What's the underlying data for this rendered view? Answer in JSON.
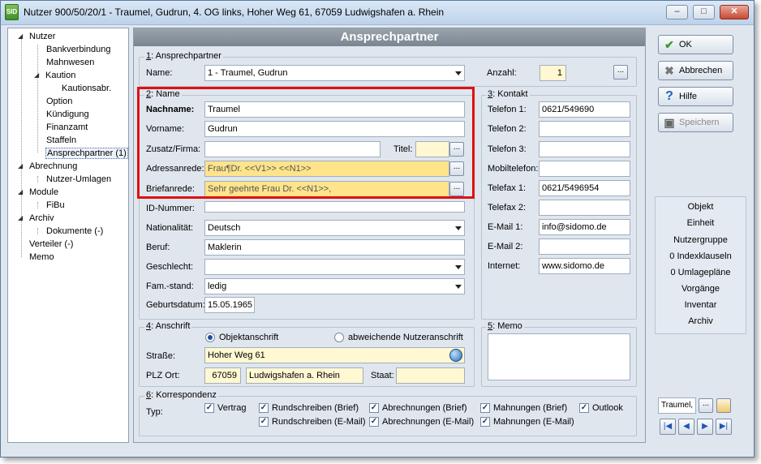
{
  "window": {
    "title": "Nutzer 900/50/20/1 - Traumel, Gudrun, 4. OG links, Hoher Weg 61, 67059 Ludwigshafen a. Rhein",
    "icon_text": "SID",
    "minimize": "‒",
    "maximize": "□",
    "close": "✕"
  },
  "tree": [
    {
      "label": "Nutzer",
      "toggle": "◢"
    },
    {
      "label": "Bankverbindung"
    },
    {
      "label": "Mahnwesen"
    },
    {
      "label": "Kaution",
      "toggle": "◢"
    },
    {
      "label": "Kautionsabr."
    },
    {
      "label": "Option"
    },
    {
      "label": "Kündigung"
    },
    {
      "label": "Finanzamt"
    },
    {
      "label": "Staffeln"
    },
    {
      "label": "Ansprechpartner (1)"
    },
    {
      "label": "Abrechnung",
      "toggle": "◢"
    },
    {
      "label": "Nutzer-Umlagen"
    },
    {
      "label": "Module",
      "toggle": "◢"
    },
    {
      "label": "FiBu"
    },
    {
      "label": "Archiv",
      "toggle": "◢"
    },
    {
      "label": "Dokumente (-)"
    },
    {
      "label": "Verteiler (-)"
    },
    {
      "label": "Memo"
    }
  ],
  "header": {
    "title": "Ansprechpartner"
  },
  "group1": {
    "num": "1",
    "title": ": Ansprechpartner",
    "name_label": "Name:",
    "name_value": "1 - Traumel, Gudrun",
    "anzahl_label": "Anzahl:",
    "anzahl_value": "1",
    "more": "..."
  },
  "group2": {
    "num": "2",
    "title": ": Name",
    "nachname_label": "Nachname:",
    "nachname_value": "Traumel",
    "vorname_label": "Vorname:",
    "vorname_value": "Gudrun",
    "zusatz_label": "Zusatz/Firma:",
    "zusatz_value": "",
    "titel_label": "Titel:",
    "titel_value": "",
    "adressanrede_label": "Adressanrede:",
    "adressanrede_value": "Frau¶Dr. <<V1>> <<N1>>",
    "briefanrede_label": "Briefanrede:",
    "briefanrede_value": "Sehr geehrte Frau Dr. <<N1>>,",
    "idnummer_label": "ID-Nummer:",
    "idnummer_value": "",
    "nationalitaet_label": "Nationalität:",
    "nationalitaet_value": "Deutsch",
    "beruf_label": "Beruf:",
    "beruf_value": "Maklerin",
    "geschlecht_label": "Geschlecht:",
    "geschlecht_value": "",
    "famstand_label": "Fam.-stand:",
    "famstand_value": "ledig",
    "geburtsdatum_label": "Geburtsdatum:",
    "geburtsdatum_value": "15.05.1965",
    "more": "..."
  },
  "group3": {
    "num": "3",
    "title": ": Kontakt",
    "rows": [
      {
        "label": "Telefon 1:",
        "value": "0621/549690"
      },
      {
        "label": "Telefon 2:",
        "value": ""
      },
      {
        "label": "Telefon 3:",
        "value": ""
      },
      {
        "label": "Mobiltelefon:",
        "value": ""
      },
      {
        "label": "Telefax 1:",
        "value": "0621/5496954"
      },
      {
        "label": "Telefax 2:",
        "value": ""
      },
      {
        "label": "E-Mail 1:",
        "value": "info@sidomo.de"
      },
      {
        "label": "E-Mail 2:",
        "value": ""
      },
      {
        "label": "Internet:",
        "value": "www.sidomo.de"
      }
    ]
  },
  "group4": {
    "num": "4",
    "title": ": Anschrift",
    "radio_object": "Objektanschrift",
    "radio_other": "abweichende Nutzeranschrift",
    "strasse_label": "Straße:",
    "strasse_value": "Hoher Weg 61",
    "plz_label": "PLZ Ort:",
    "plz_value": "67059",
    "ort_value": "Ludwigshafen a. Rhein",
    "staat_label": "Staat:",
    "staat_value": ""
  },
  "group5": {
    "num": "5",
    "title": ": Memo",
    "value": ""
  },
  "group6": {
    "num": "6",
    "title": ": Korrespondenz",
    "typ_label": "Typ:",
    "check_mark": "✓",
    "checks": [
      "Vertrag",
      "Rundschreiben (Brief)",
      "Abrechnungen (Brief)",
      "Mahnungen (Brief)",
      "Outlook",
      "Rundschreiben (E-Mail)",
      "Abrechnungen (E-Mail)",
      "Mahnungen (E-Mail)"
    ]
  },
  "actions": {
    "ok": "OK",
    "abbrechen": "Abbrechen",
    "hilfe": "Hilfe",
    "speichern": "Speichern",
    "ok_icon": "✔",
    "abbrechen_icon": "✖",
    "hilfe_icon": "?",
    "speichern_icon": "▣"
  },
  "right_list": [
    "Objekt",
    "Einheit",
    "Nutzergruppe",
    "0 Indexklauseln",
    "0 Umlagepläne",
    "Vorgänge",
    "Inventar",
    "Archiv"
  ],
  "nav": {
    "current": "Traumel,",
    "more": "...",
    "first": "|◀",
    "prev": "◀",
    "next": "▶",
    "last": "▶|"
  }
}
